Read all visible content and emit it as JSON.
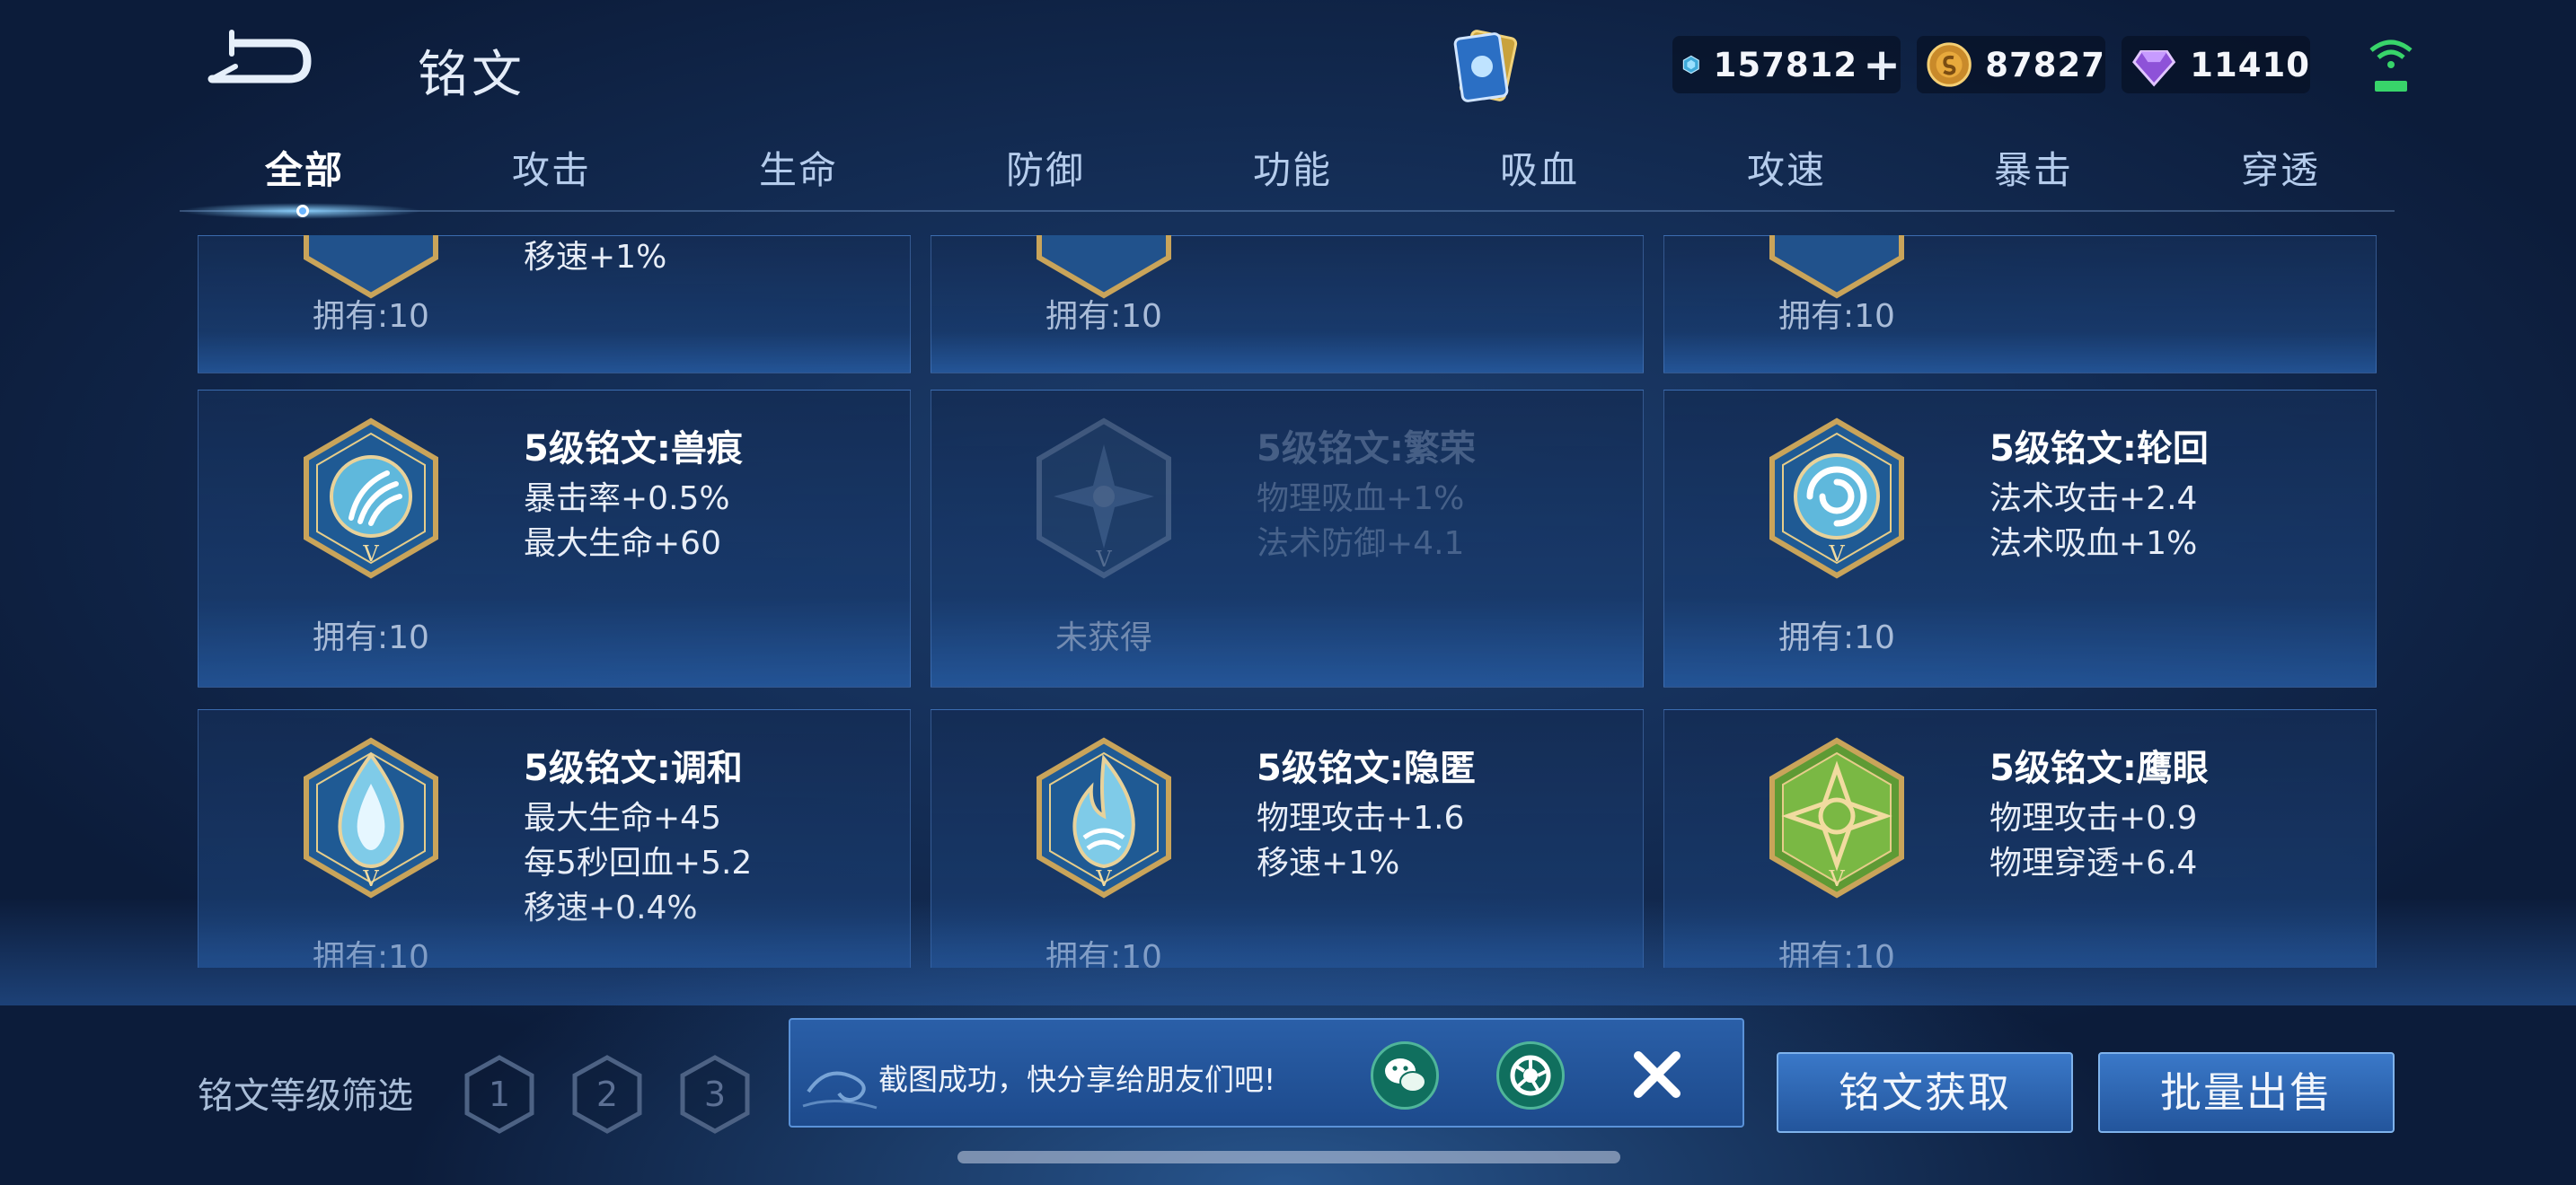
{
  "header": {
    "title": "铭文",
    "back_icon": "back-arrow-icon",
    "currencies": [
      {
        "name": "diamond",
        "icon": "diamond-icon",
        "value": "157812"
      },
      {
        "name": "gold",
        "icon": "gold-coin-icon",
        "value": "87827"
      },
      {
        "name": "gem",
        "icon": "purple-gem-icon",
        "value": "11410"
      }
    ],
    "plus": "+"
  },
  "tabs": [
    "全部",
    "攻击",
    "生命",
    "防御",
    "功能",
    "吸血",
    "攻速",
    "暴击",
    "穿透"
  ],
  "active_tab": "全部",
  "top_row": {
    "partial_stat": "移速+1%",
    "owned": [
      "拥有:10",
      "拥有:10",
      "拥有:10"
    ]
  },
  "cards": [
    {
      "name": "5级铭文:兽痕",
      "stats": [
        "暴击率+0.5%",
        "最大生命+60"
      ],
      "owned": "拥有:10",
      "icon": "claw-mark-icon",
      "color": "#5fb8dc"
    },
    {
      "name": "5级铭文:繁荣",
      "stats": [
        "物理吸血+1%",
        "法术防御+4.1"
      ],
      "owned": "未获得",
      "icon": "star-flower-icon",
      "color": "#7a8ea8"
    },
    {
      "name": "5级铭文:轮回",
      "stats": [
        "法术攻击+2.4",
        "法术吸血+1%"
      ],
      "owned": "拥有:10",
      "icon": "swirl-icon",
      "color": "#5fb8dc"
    },
    {
      "name": "5级铭文:调和",
      "stats": [
        "最大生命+45",
        "每5秒回血+5.2",
        "移速+0.4%"
      ],
      "owned": "拥有:10",
      "icon": "drop-icon",
      "color": "#5fb8dc"
    },
    {
      "name": "5级铭文:隐匿",
      "stats": [
        "物理攻击+1.6",
        "移速+1%"
      ],
      "owned": "拥有:10",
      "icon": "flame-icon",
      "color": "#5fb8dc"
    },
    {
      "name": "5级铭文:鹰眼",
      "stats": [
        "物理攻击+0.9",
        "物理穿透+6.4"
      ],
      "owned": "拥有:10",
      "icon": "hawk-eye-icon",
      "color": "#7ab844"
    }
  ],
  "emblem_level": "V",
  "filter": {
    "label": "铭文等级筛选",
    "levels": [
      "1",
      "2",
      "3"
    ]
  },
  "toast": {
    "message": "截图成功，快分享给朋友们吧!"
  },
  "buttons": {
    "obtain": "铭文获取",
    "sell": "批量出售"
  }
}
